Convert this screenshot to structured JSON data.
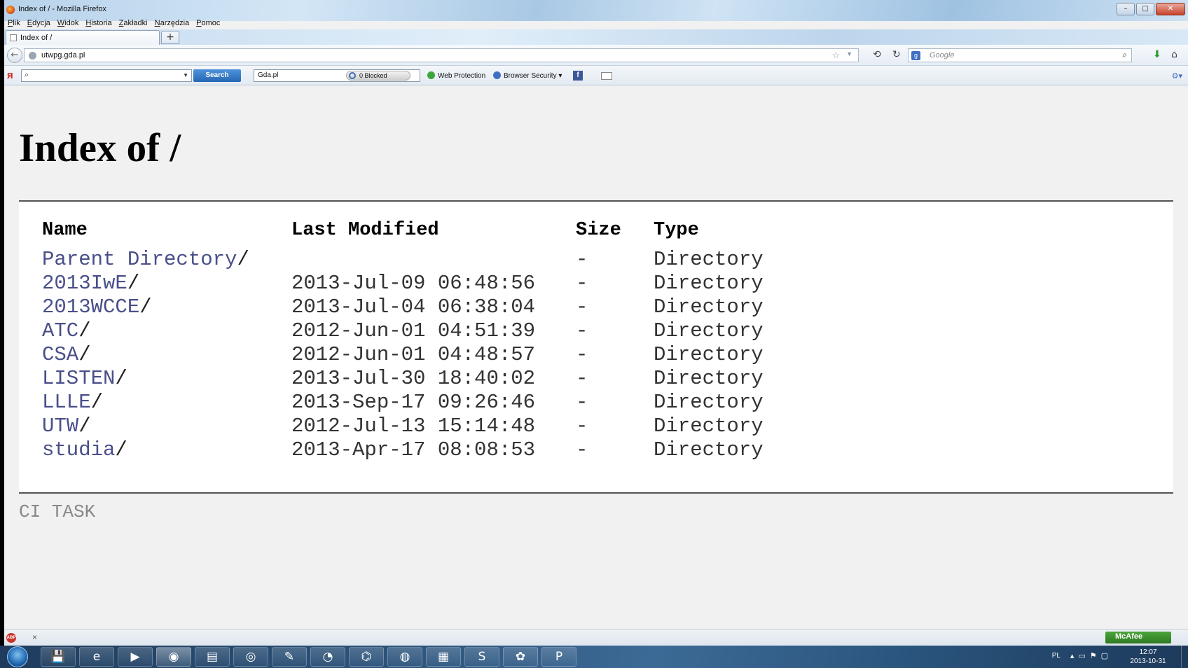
{
  "window": {
    "title": "Index of / - Mozilla Firefox",
    "controls": {
      "minimize": "–",
      "maximize": "□",
      "close": "✕"
    }
  },
  "menubar": [
    "Plik",
    "Edycja",
    "Widok",
    "Historia",
    "Zakładki",
    "Narzędzia",
    "Pomoc"
  ],
  "tab": {
    "label": "Index of /",
    "new_tab": "+"
  },
  "navbar": {
    "url": "utwpg.gda.pl",
    "search_placeholder": "Google"
  },
  "addonbar": {
    "search_field_value": "",
    "search_button": "Search",
    "site_field": "Gda.pl",
    "blocked_label": "0 Blocked",
    "web_protection": "Web Protection",
    "browser_security": "Browser Security"
  },
  "page": {
    "title": "Index of /",
    "columns": {
      "name": "Name",
      "modified": "Last Modified",
      "size": "Size",
      "type": "Type"
    },
    "entries": [
      {
        "name": "Parent Directory",
        "modified": "",
        "size": "-",
        "type": "Directory"
      },
      {
        "name": "2013IwE",
        "modified": "2013-Jul-09 06:48:56",
        "size": "-",
        "type": "Directory"
      },
      {
        "name": "2013WCCE",
        "modified": "2013-Jul-04 06:38:04",
        "size": "-",
        "type": "Directory"
      },
      {
        "name": "ATC",
        "modified": "2012-Jun-01 04:51:39",
        "size": "-",
        "type": "Directory"
      },
      {
        "name": "CSA",
        "modified": "2012-Jun-01 04:48:57",
        "size": "-",
        "type": "Directory"
      },
      {
        "name": "LISTEN",
        "modified": "2013-Jul-30 18:40:02",
        "size": "-",
        "type": "Directory"
      },
      {
        "name": "LLLE",
        "modified": "2013-Sep-17 09:26:46",
        "size": "-",
        "type": "Directory"
      },
      {
        "name": "UTW",
        "modified": "2012-Jul-13 15:14:48",
        "size": "-",
        "type": "Directory"
      },
      {
        "name": "studia",
        "modified": "2013-Apr-17 08:08:53",
        "size": "-",
        "type": "Directory"
      }
    ],
    "footer": "CI TASK"
  },
  "statusbar": {
    "close": "×",
    "mcafee": "McAfee"
  },
  "taskbar": {
    "language": "PL",
    "time": "12:07",
    "date": "2013-10-31",
    "apps": [
      "save-icon",
      "internet-explorer-icon",
      "media-player-icon",
      "firefox-icon",
      "file-explorer-icon",
      "chrome-icon",
      "paint-icon",
      "pie-chart-app-icon",
      "network-app-icon",
      "globe-app-icon",
      "tile-app-icon",
      "skype-icon",
      "picasa-icon",
      "powerpoint-icon"
    ]
  },
  "colors": {
    "link": "#4a4f8a",
    "listing_bg": "#ffffff",
    "page_bg": "#f1f1f1",
    "footer_text": "#888888"
  }
}
